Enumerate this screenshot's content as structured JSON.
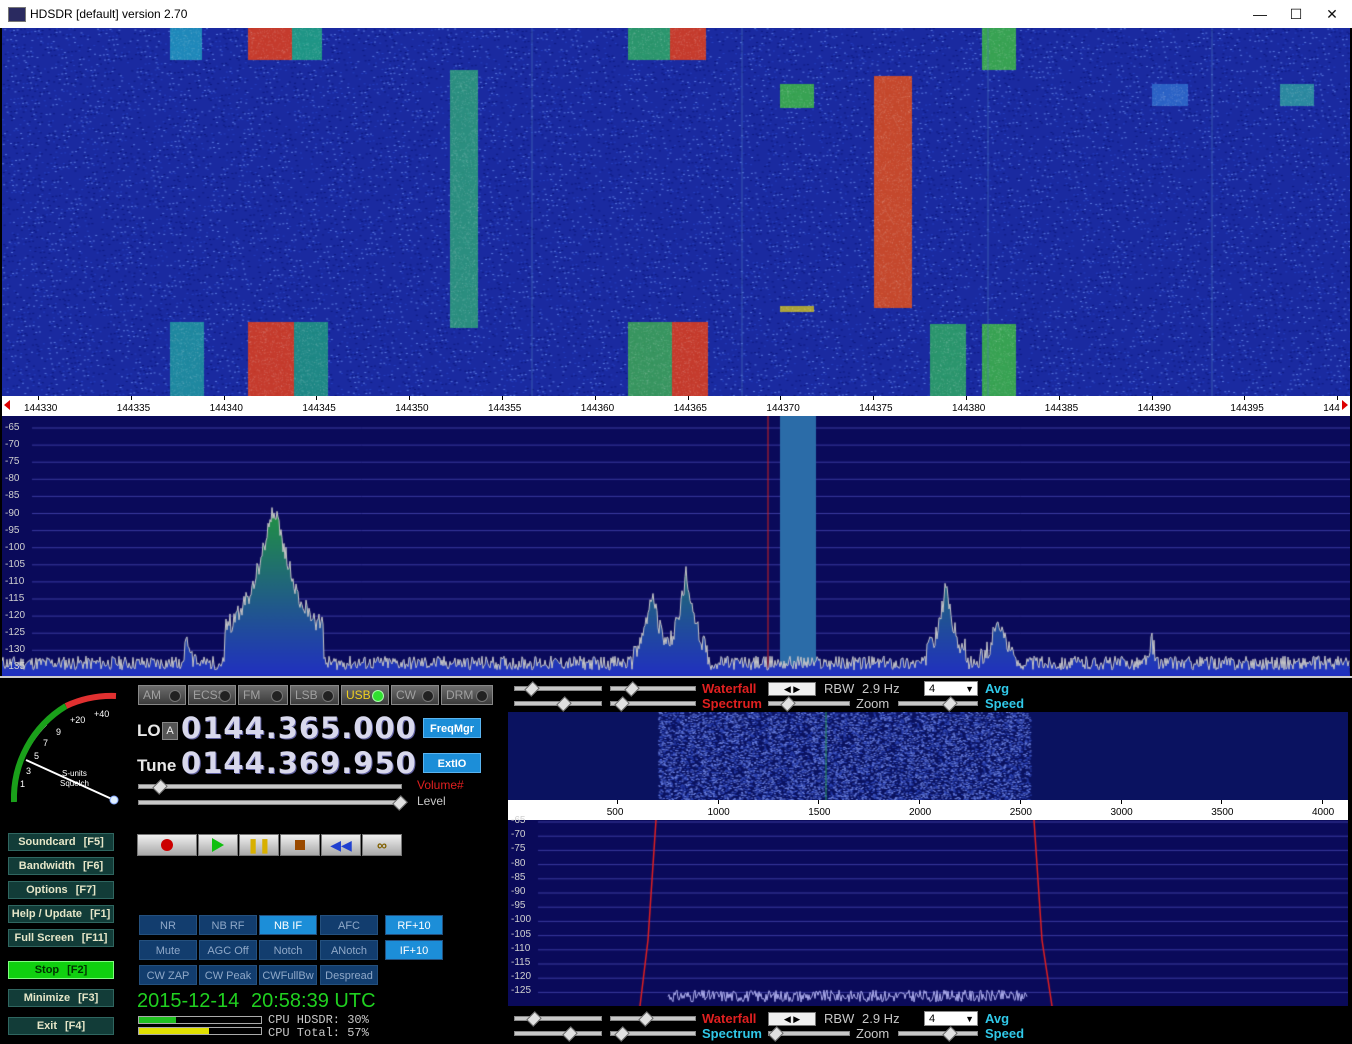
{
  "window": {
    "title": "HDSDR [default]  version 2.70",
    "minimize_glyph": "—",
    "maximize_glyph": "☐",
    "close_glyph": "✕"
  },
  "main_scale": {
    "ticks": [
      "144330",
      "144335",
      "144340",
      "144345",
      "144350",
      "144355",
      "144360",
      "144365",
      "144370",
      "144375",
      "144380",
      "144385",
      "144390",
      "144395",
      "144"
    ]
  },
  "main_spectrum": {
    "db_labels": [
      "-65",
      "-70",
      "-75",
      "-80",
      "-85",
      "-90",
      "-95",
      "-100",
      "-105",
      "-110",
      "-115",
      "-120",
      "-125",
      "-130",
      "-135"
    ]
  },
  "smeter": {
    "scale_labels": [
      "1",
      "3",
      "5",
      "7",
      "9",
      "+20",
      "+40"
    ],
    "label1": "S-units",
    "label2": "Squelch"
  },
  "modes": [
    {
      "label": "AM",
      "active": false
    },
    {
      "label": "ECSS",
      "active": false
    },
    {
      "label": "FM",
      "active": false
    },
    {
      "label": "LSB",
      "active": false
    },
    {
      "label": "USB",
      "active": true
    },
    {
      "label": "CW",
      "active": false
    },
    {
      "label": "DRM",
      "active": false
    }
  ],
  "lo": {
    "label": "LO",
    "tag": "A",
    "value": "0144.365.000"
  },
  "tune": {
    "label": "Tune",
    "value": "0144.369.950"
  },
  "buttons": {
    "freqmgr": "FreqMgr",
    "extio": "ExtIO"
  },
  "volume": {
    "label": "Volume#",
    "level_label": "Level"
  },
  "side_buttons": [
    {
      "label": "Soundcard",
      "key": "[F5]"
    },
    {
      "label": "Bandwidth",
      "key": "[F6]"
    },
    {
      "label": "Options",
      "key": "[F7]"
    },
    {
      "label": "Help / Update",
      "key": "[F1]"
    },
    {
      "label": "Full Screen",
      "key": "[F11]"
    },
    {
      "label": "Stop",
      "key": "[F2]"
    },
    {
      "label": "Minimize",
      "key": "[F3]"
    },
    {
      "label": "Exit",
      "key": "[F4]"
    }
  ],
  "dsp_buttons": [
    {
      "label": "NR",
      "on": false
    },
    {
      "label": "NB RF",
      "on": false
    },
    {
      "label": "NB IF",
      "on": true
    },
    {
      "label": "AFC",
      "on": false
    },
    {
      "label": "RF+10",
      "on": true
    },
    {
      "label": "Mute",
      "on": false
    },
    {
      "label": "AGC Off",
      "on": false
    },
    {
      "label": "Notch",
      "on": false
    },
    {
      "label": "ANotch",
      "on": false
    },
    {
      "label": "IF+10",
      "on": true
    },
    {
      "label": "CW ZAP",
      "on": false
    },
    {
      "label": "CW Peak",
      "on": false
    },
    {
      "label": "CWFullBw",
      "on": false
    },
    {
      "label": "Despread",
      "on": false
    }
  ],
  "status": {
    "date": "2015-12-14",
    "time": "20:58:39 UTC",
    "cpu_hdsdr": "CPU HDSDR: 30%",
    "cpu_total": "CPU Total: 57%",
    "cpu_hdsdr_pct": 30,
    "cpu_total_pct": 57
  },
  "rf_controls": {
    "waterfall": "Waterfall",
    "spectrum": "Spectrum",
    "rbw_label": "RBW",
    "rbw_value": "2.9 Hz",
    "zoom": "Zoom",
    "avg_value": "4",
    "avg": "Avg",
    "speed": "Speed"
  },
  "af_scale": {
    "ticks": [
      "500",
      "1000",
      "1500",
      "2000",
      "2500",
      "3000",
      "3500",
      "4000"
    ]
  },
  "af_spectrum": {
    "db_labels": [
      "-65",
      "-70",
      "-75",
      "-80",
      "-85",
      "-90",
      "-95",
      "-100",
      "-105",
      "-110",
      "-115",
      "-120",
      "-125",
      "-130"
    ]
  },
  "af_controls": {
    "waterfall": "Waterfall",
    "spectrum": "Spectrum",
    "rbw_label": "RBW",
    "rbw_value": "2.9 Hz",
    "zoom": "Zoom",
    "avg_value": "4",
    "avg": "Avg",
    "speed": "Speed"
  },
  "colors": {
    "accent_blue": "#1c8ed8",
    "waterfall_bg": "#1a2aa0",
    "spectrum_bg": "#0a0a5a",
    "red_label": "#e02020",
    "cyan_label": "#30c8e8",
    "stop_green": "#20d020"
  }
}
